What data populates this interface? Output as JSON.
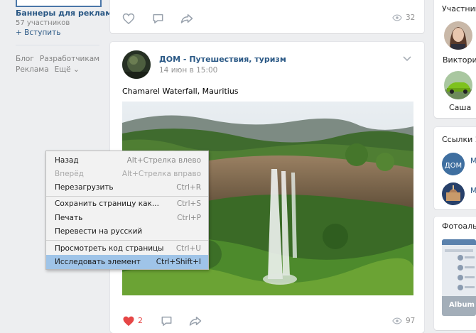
{
  "left_column": {
    "group_name": "Баннеры для рекламы",
    "group_members": "57 участников",
    "join_label": "+ Вступить",
    "footer_links_row1": [
      "Блог",
      "Разработчикам"
    ],
    "footer_links_row2": [
      "Реклама",
      "Ещё ⌄"
    ]
  },
  "post1": {
    "views": "32"
  },
  "post2": {
    "author": "ДОМ - Путешествия, туризм",
    "date": "14 июн в 15:00",
    "text": "Chamarel Waterfall, Mauritius",
    "likes": "2",
    "views": "97"
  },
  "right_column": {
    "members_title": "Участники",
    "members": [
      {
        "name": "Виктория"
      },
      {
        "name": "Саша"
      }
    ],
    "links_title": "Ссылки",
    "links_count": "2",
    "links": [
      {
        "label": "М"
      },
      {
        "label": "М"
      }
    ],
    "albums_title": "Фотоальбо",
    "album_label": "Album"
  },
  "context_menu": {
    "items": [
      {
        "label": "Назад",
        "shortcut": "Alt+Стрелка влево",
        "disabled": false
      },
      {
        "label": "Вперёд",
        "shortcut": "Alt+Стрелка вправо",
        "disabled": true
      },
      {
        "label": "Перезагрузить",
        "shortcut": "Ctrl+R",
        "disabled": false
      },
      {
        "label": "Сохранить страницу как...",
        "shortcut": "Ctrl+S",
        "disabled": false
      },
      {
        "label": "Печать",
        "shortcut": "Ctrl+P",
        "disabled": false
      },
      {
        "label": "Перевести на русский",
        "shortcut": "",
        "disabled": false
      },
      {
        "label": "Просмотреть код страницы",
        "shortcut": "Ctrl+U",
        "disabled": false
      },
      {
        "label": "Исследовать элемент",
        "shortcut": "Ctrl+Shift+I",
        "disabled": false,
        "highlighted": true
      }
    ]
  },
  "colors": {
    "link_blue": "#2a5885",
    "page_bg": "#edeef0",
    "like_red": "#e64646",
    "menu_highlight": "#9fc4e8"
  }
}
